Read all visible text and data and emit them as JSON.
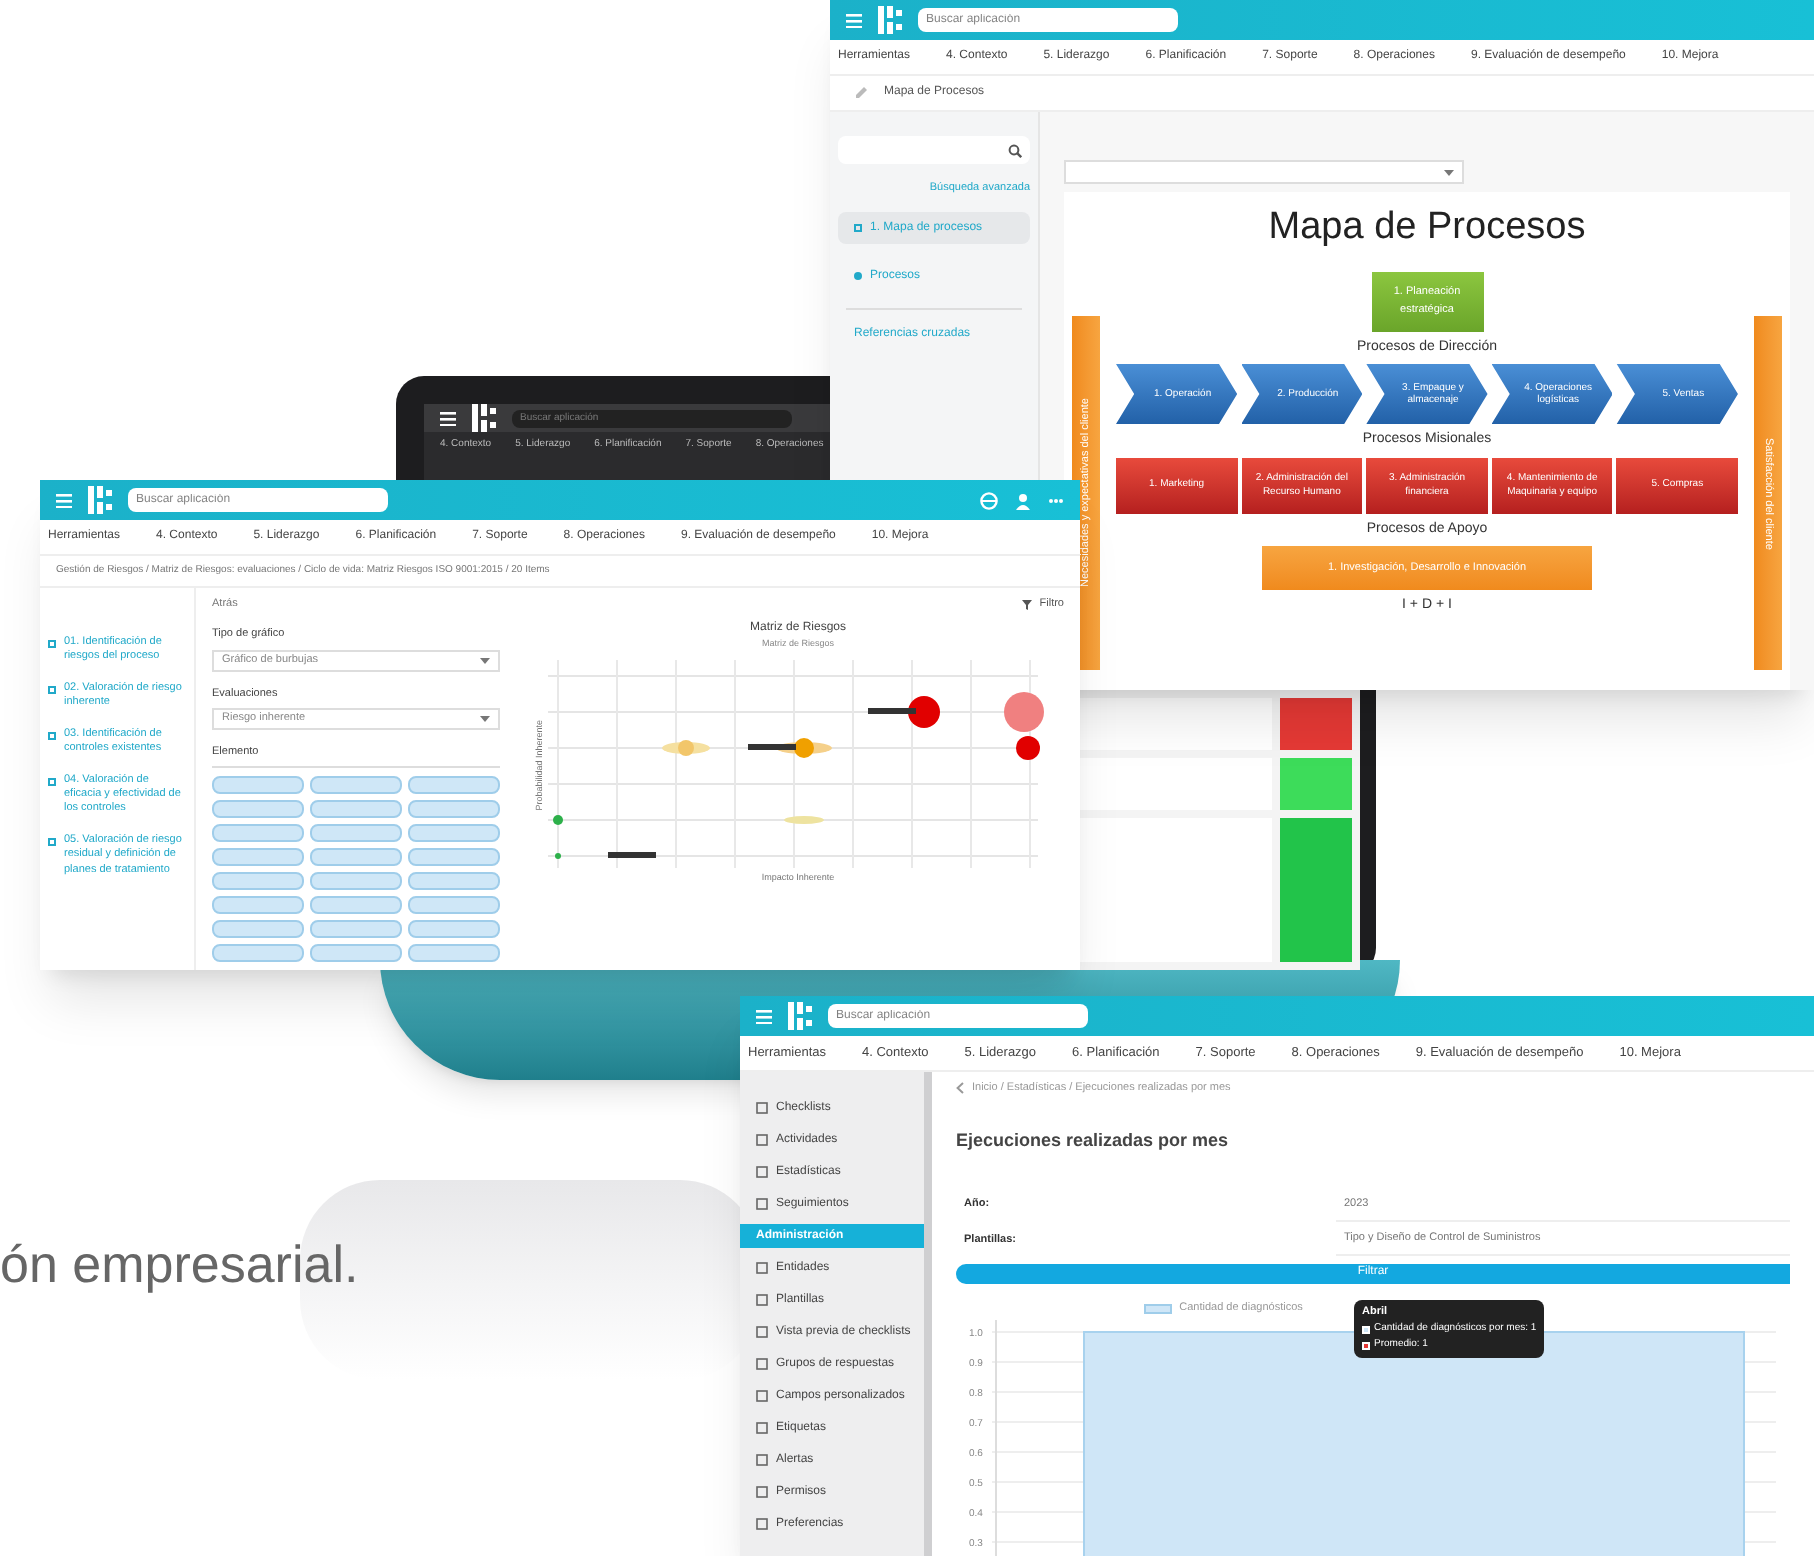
{
  "intro_text": "ón empresarial.",
  "laptop_screen": {
    "search_placeholder": "Buscar aplicación",
    "nav": [
      "4. Contexto",
      "5. Liderazgo",
      "6. Planificación",
      "7. Soporte",
      "8. Operaciones"
    ]
  },
  "process_map_window": {
    "search_placeholder": "Buscar aplicación",
    "nav": [
      "Herramientas",
      "4. Contexto",
      "5. Liderazgo",
      "6. Planificación",
      "7. Soporte",
      "8. Operaciones",
      "9. Evaluación de desempeño",
      "10. Mejora"
    ],
    "breadcrumb": "Mapa de Procesos",
    "advanced_search": "Búsqueda avanzada",
    "sidebar": [
      {
        "label": "1. Mapa de procesos",
        "selected": true
      },
      {
        "label": "Procesos",
        "selected": false
      }
    ],
    "cross_references": "Referencias cruzadas",
    "map": {
      "title": "Mapa de Procesos",
      "left_bar": "Necesidades y expectativas del cliente",
      "right_bar": "Satisfacción del cliente",
      "strategic": "1. Planeación estratégica",
      "direction_label": "Procesos de Dirección",
      "missional": [
        "1. Operación",
        "2. Producción",
        "3. Empaque y almacenaje",
        "4. Operaciones logísticas",
        "5. Ventas"
      ],
      "missional_label": "Procesos Misionales",
      "support": [
        "1. Marketing",
        "2. Administración del Recurso Humano",
        "3. Administración financiera",
        "4. Mantenimiento de Maquinaria y equipo",
        "5. Compras"
      ],
      "support_label": "Procesos de Apoyo",
      "innovation": "1. Investigación, Desarrollo e Innovación",
      "footer": "I + D + I"
    }
  },
  "risk_window": {
    "search_placeholder": "Buscar aplicación",
    "nav": [
      "Herramientas",
      "4. Contexto",
      "5. Liderazgo",
      "6. Planificación",
      "7. Soporte",
      "8. Operaciones",
      "9. Evaluación de desempeño",
      "10. Mejora"
    ],
    "breadcrumb": "Gestión de Riesgos / Matriz de Riesgos: evaluaciones / Ciclo de vida: Matriz Riesgos ISO 9001:2015 / 20 Items",
    "sidebar": [
      {
        "label": "01. Identificación de riesgos del proceso",
        "selected": false
      },
      {
        "label": "02. Valoración de riesgo inherente",
        "selected": false
      },
      {
        "label": "03. Identificación de controles existentes",
        "selected": false
      },
      {
        "label": "04. Valoración de eficacia y efectividad de los controles",
        "selected": false
      },
      {
        "label": "05. Valoración de riesgo residual y definición de planes de tratamiento",
        "selected": false
      }
    ],
    "back": "Atrás",
    "filter": "Filtro",
    "chart_type_label": "Tipo de gráfico",
    "chart_type_value": "Gráfico de burbujas",
    "evaluations_label": "Evaluaciones",
    "evaluations_value": "Riesgo inherente",
    "element_label": "Elemento",
    "chart_title": "Matriz de Riesgos",
    "chart_subtitle": "Matriz de Riesgos",
    "x_axis": "Impacto Inherente",
    "y_axis": "Probabilidad Inherente"
  },
  "executions_window": {
    "search_placeholder": "Buscar aplicación",
    "nav": [
      "Herramientas",
      "4. Contexto",
      "5. Liderazgo",
      "6. Planificación",
      "7. Soporte",
      "8. Operaciones",
      "9. Evaluación de desempeño",
      "10. Mejora"
    ],
    "sidebar": [
      {
        "label": "Checklists",
        "selected": false
      },
      {
        "label": "Actividades",
        "selected": false
      },
      {
        "label": "Estadísticas",
        "selected": false
      },
      {
        "label": "Seguimientos",
        "selected": false
      },
      {
        "label": "Administración",
        "selected": true
      },
      {
        "label": "Entidades",
        "selected": false
      },
      {
        "label": "Plantillas",
        "selected": false
      },
      {
        "label": "Vista previa de checklists",
        "selected": false
      },
      {
        "label": "Grupos de respuestas",
        "selected": false
      },
      {
        "label": "Campos personalizados",
        "selected": false
      },
      {
        "label": "Etiquetas",
        "selected": false
      },
      {
        "label": "Alertas",
        "selected": false
      },
      {
        "label": "Permisos",
        "selected": false
      },
      {
        "label": "Preferencias",
        "selected": false
      }
    ],
    "breadcrumb": "Inicio / Estadísticas / Ejecuciones realizadas por mes",
    "title": "Ejecuciones realizadas por mes",
    "fields": [
      {
        "label": "Año:",
        "value": "2023"
      },
      {
        "label": "Plantillas:",
        "value": "Tipo y Diseño de Control de Suministros"
      }
    ],
    "filter_button": "Filtrar",
    "legend": "Cantidad de diagnósticos",
    "tooltip": {
      "title": "Abril",
      "lines": [
        {
          "text": "Cantidad de diagnósticos por mes: 1",
          "color": "#cfe6f7"
        },
        {
          "text": "Promedio: 1",
          "color": "#e53935"
        }
      ]
    },
    "chart_data": {
      "type": "bar",
      "grid": true,
      "ylim": [
        0.25,
        1
      ],
      "series": [
        {
          "color": "#cfe6f7",
          "values": [
            1
          ]
        }
      ],
      "yticks": [
        {
          "value": 1,
          "label": "1.0"
        },
        {
          "value": 0.9,
          "label": "0.9"
        },
        {
          "value": 0.8,
          "label": "0.8"
        },
        {
          "value": 0.7,
          "label": "0.7"
        },
        {
          "value": 0.6,
          "label": "0.6"
        },
        {
          "value": 0.5,
          "label": "0.5"
        },
        {
          "value": 0.4,
          "label": "0.4"
        },
        {
          "value": 0.3,
          "label": "0.3"
        }
      ]
    }
  }
}
